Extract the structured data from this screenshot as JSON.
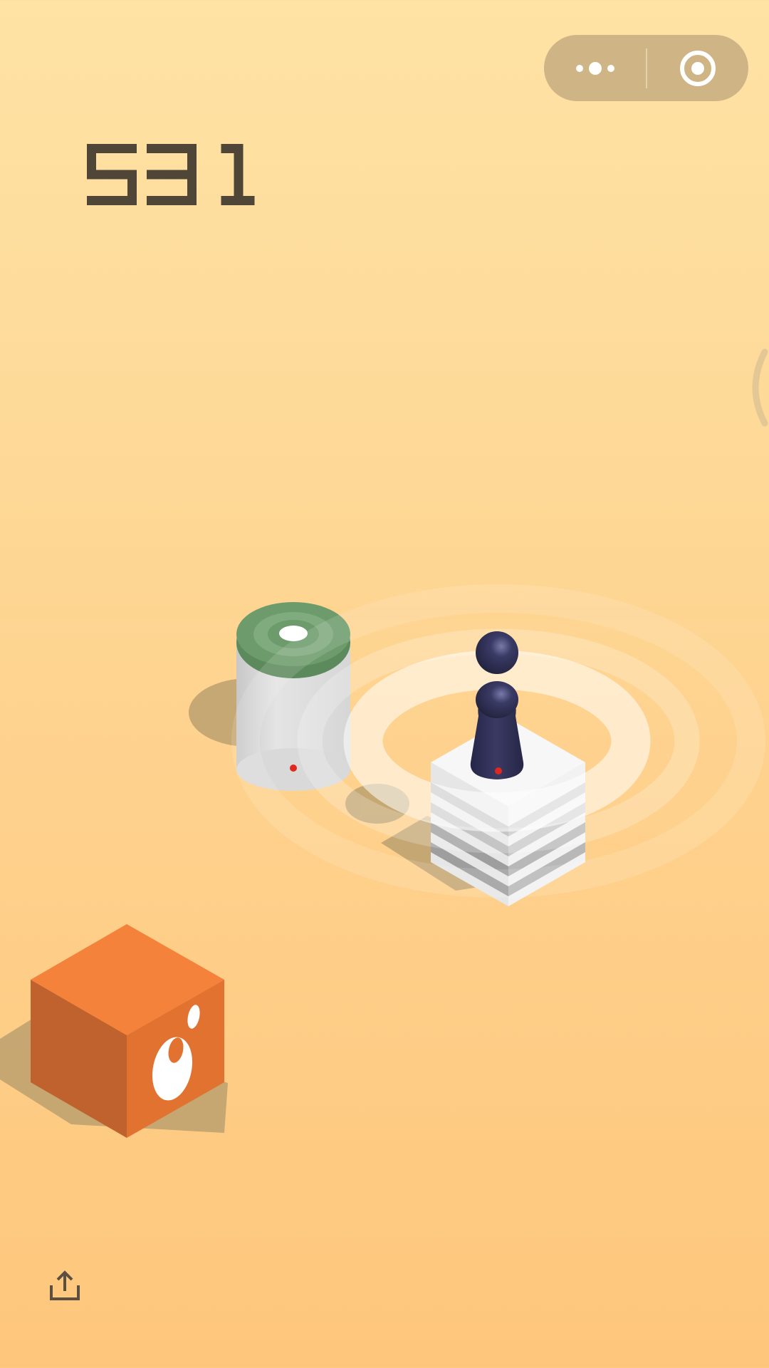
{
  "hud": {
    "score": "531"
  },
  "menu_capsule": {
    "more_icon": "more-dots-icon",
    "close_icon": "target-close-icon",
    "background": "#cfb586"
  },
  "share": {
    "icon": "share-upload-icon"
  },
  "colors": {
    "background_top": "#fee3a5",
    "background_bottom": "#fec67c",
    "score_text": "#4f4638",
    "orange_cube": "#f5823a",
    "green_cylinder_top": "#6d9b6c",
    "player": "#2f2f55"
  }
}
